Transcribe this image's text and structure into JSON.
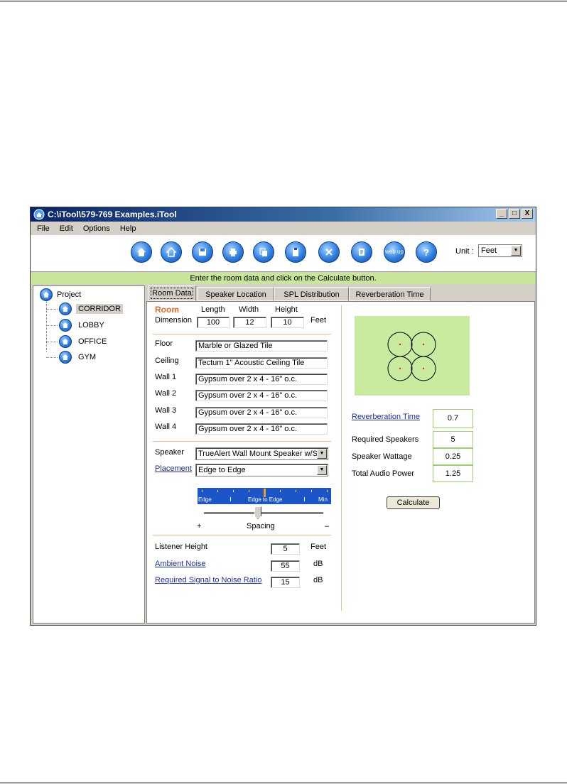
{
  "window": {
    "title": "C:\\iTool\\579-769 Examples.iTool",
    "controls": {
      "minimize": "_",
      "maximize": "□",
      "close": "X"
    }
  },
  "menu": [
    "File",
    "Edit",
    "Options",
    "Help"
  ],
  "toolbar": {
    "buttons": [
      {
        "icon": "home-icon"
      },
      {
        "icon": "new-room-icon"
      },
      {
        "icon": "save-icon"
      },
      {
        "icon": "print-icon"
      },
      {
        "icon": "copy-icon"
      },
      {
        "icon": "paste-icon"
      },
      {
        "icon": "delete-icon"
      },
      {
        "icon": "report-icon"
      },
      {
        "icon": "web-update-icon",
        "label": "web up"
      },
      {
        "icon": "help-icon",
        "label": "?"
      }
    ],
    "unit_label": "Unit :",
    "unit_value": "Feet"
  },
  "status": "Enter the room data and click on the Calculate button.",
  "tree": {
    "root": "Project",
    "items": [
      "CORRIDOR",
      "LOBBY",
      "OFFICE",
      "GYM"
    ],
    "selected": "CORRIDOR"
  },
  "tabs": [
    "Room Data",
    "Speaker Location",
    "SPL Distribution",
    "Reverberation Time"
  ],
  "room": {
    "heading": "Room",
    "dimension_label": "Dimension",
    "length_label": "Length",
    "width_label": "Width",
    "height_label": "Height",
    "length": "100",
    "width": "12",
    "height": "10",
    "unit": "Feet"
  },
  "surfaces": [
    {
      "label": "Floor",
      "value": "Marble or Glazed Tile"
    },
    {
      "label": "Ceiling",
      "value": "Tectum 1\" Acoustic Ceiling Tile"
    },
    {
      "label": "Wall 1",
      "value": "Gypsum over 2 x 4 - 16\" o.c."
    },
    {
      "label": "Wall 2",
      "value": "Gypsum over 2 x 4 - 16\" o.c."
    },
    {
      "label": "Wall 3",
      "value": "Gypsum over 2 x 4 - 16\" o.c."
    },
    {
      "label": "Wall 4",
      "value": "Gypsum over 2 x 4 - 16\" o.c."
    }
  ],
  "speaker": {
    "label": "Speaker",
    "value": "TrueAlert Wall Mount Speaker w/S",
    "placement_label": "Placement",
    "placement_value": "Edge to Edge",
    "bar_labels": [
      "Edge",
      "Edge to Edge",
      "Min"
    ],
    "spacing_label": "Spacing",
    "plus": "+",
    "minus": "–"
  },
  "listener": {
    "height_label": "Listener Height",
    "height_value": "5",
    "height_unit": "Feet",
    "noise_label": "Ambient Noise",
    "noise_value": "55",
    "noise_unit": "dB",
    "snr_label": "Required Signal to Noise Ratio",
    "snr_value": "15",
    "snr_unit": "dB"
  },
  "results": {
    "reverb_label": "Reverberation Time",
    "reverb_value": "0.7",
    "speakers_label": "Required Speakers",
    "speakers_value": "5",
    "wattage_label": "Speaker Wattage",
    "wattage_value": "0.25",
    "power_label": "Total Audio Power",
    "power_value": "1.25"
  },
  "calculate_label": "Calculate",
  "colors": {
    "status_green": "#c7e59b",
    "diagram_green": "#c8eba0",
    "room_heading": "#e06a2c",
    "link": "#1b2ea8",
    "title_bar": "#0a246a"
  }
}
